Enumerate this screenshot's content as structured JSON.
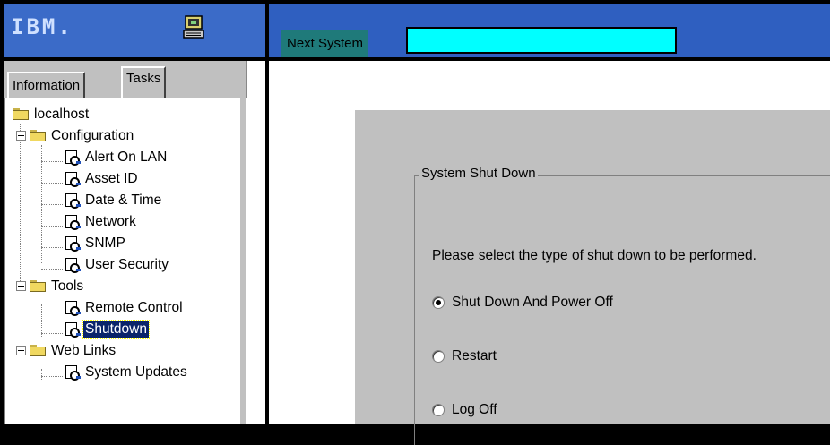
{
  "header": {
    "brand": "IBM.",
    "next_system_label": "Next System",
    "next_system_value": ""
  },
  "tabs": [
    {
      "label": "Information",
      "active": false
    },
    {
      "label": "Tasks",
      "active": true
    }
  ],
  "tree": {
    "root": "localhost",
    "groups": [
      {
        "label": "Configuration",
        "expanded": true,
        "items": [
          "Alert On LAN",
          "Asset ID",
          "Date & Time",
          "Network",
          "SNMP",
          "User Security"
        ]
      },
      {
        "label": "Tools",
        "expanded": true,
        "items": [
          "Remote Control",
          "Shutdown"
        ]
      },
      {
        "label": "Web Links",
        "expanded": true,
        "items": [
          "System Updates"
        ]
      }
    ],
    "selected": "Shutdown"
  },
  "shutdown": {
    "group_title": "System Shut Down",
    "prompt": "Please select the type of shut down to be performed.",
    "options": [
      {
        "label": "Shut Down And Power Off",
        "checked": true
      },
      {
        "label": "Restart",
        "checked": false
      },
      {
        "label": "Log Off",
        "checked": false
      }
    ]
  },
  "colors": {
    "header_blue": "#2f5fc0",
    "next_system_input": "#00ffff",
    "selection": "#0a246a"
  },
  "icons": {
    "system_icon": "computer-icon",
    "folder_icon": "folder-icon",
    "task_icon": "magnifier-task-icon"
  }
}
